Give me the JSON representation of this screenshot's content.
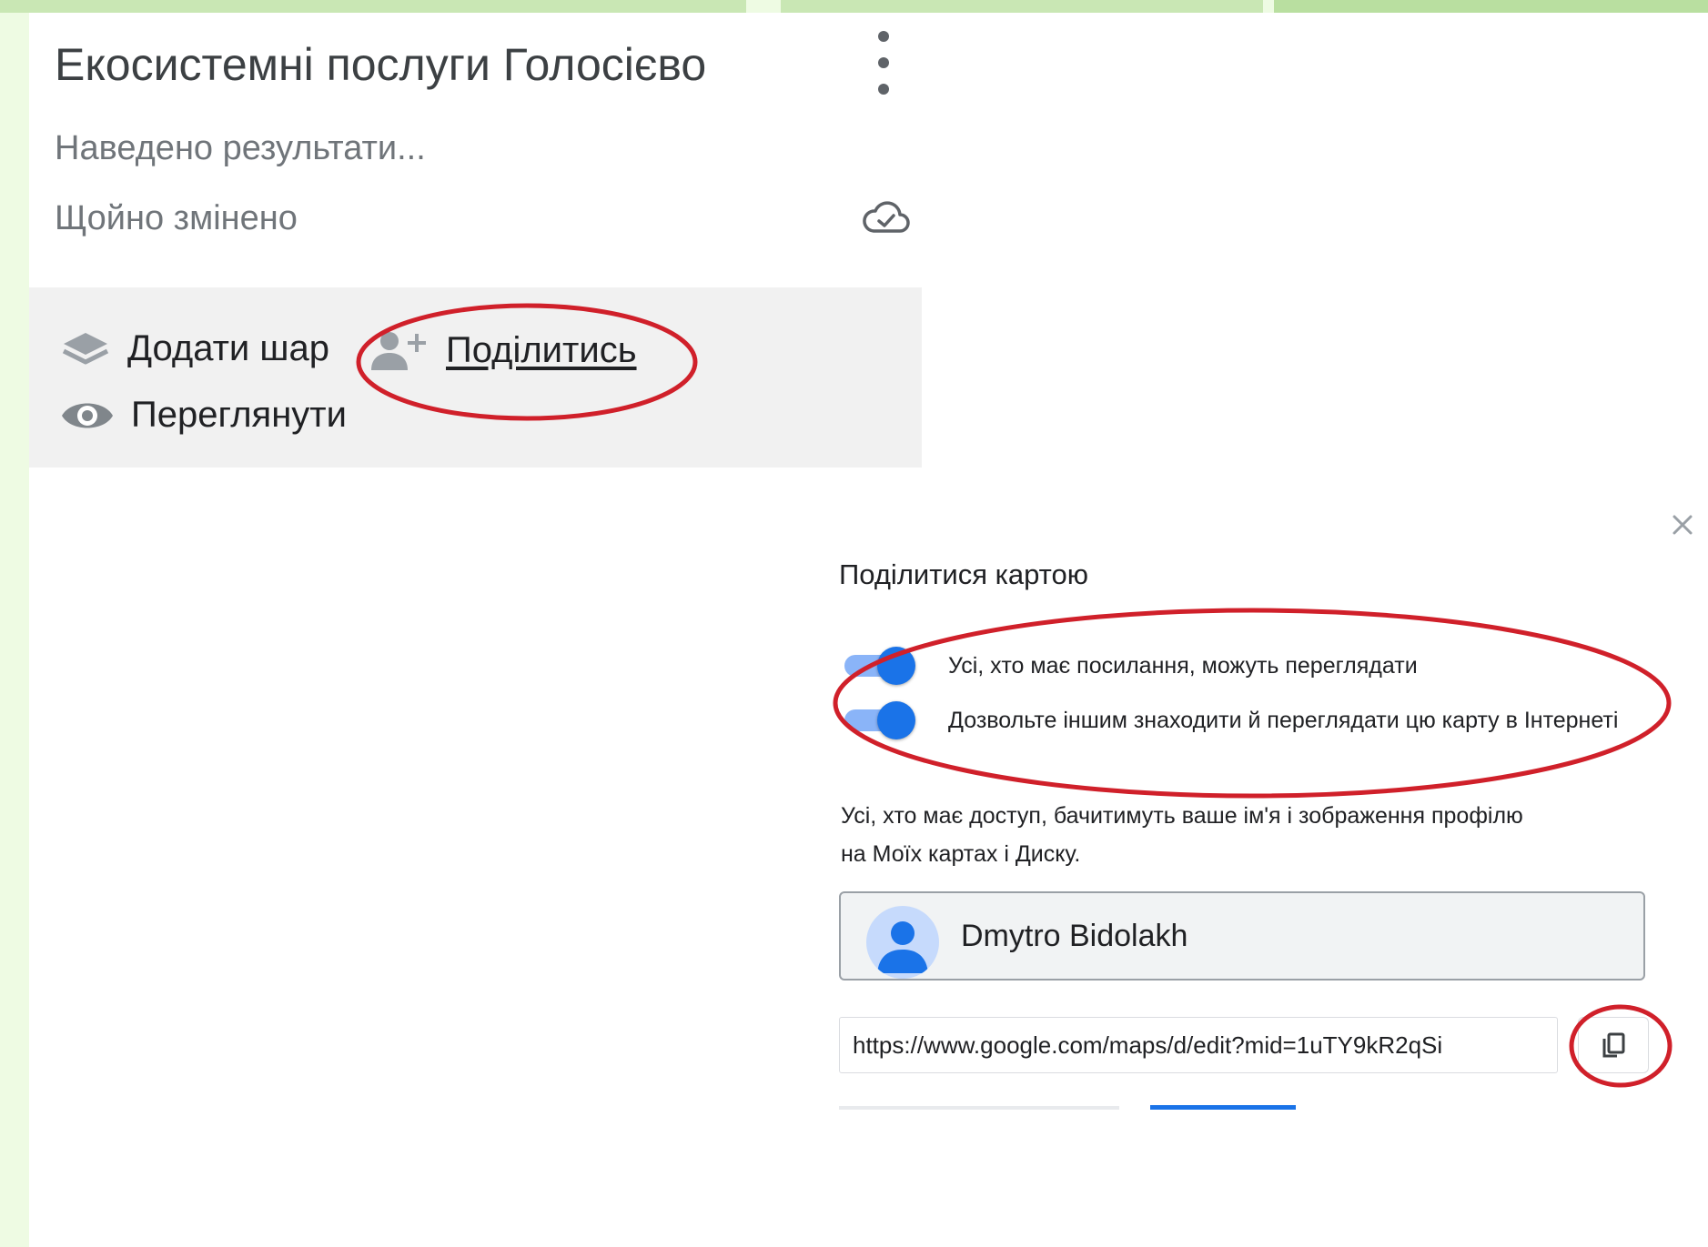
{
  "colors": {
    "background": "#eefbe3",
    "panel": "#ffffff",
    "toolbar_bg": "#f1f1f1",
    "annotation_red": "#d0202a",
    "toggle_on": "#1a73e8",
    "toggle_track": "#8ab4f8",
    "muted_text": "#70757a"
  },
  "map": {
    "title": "Екосистемні послуги Голосієво",
    "description": "Наведено результати...",
    "status": "Щойно змінено",
    "menu_icon": "more-vert-icon",
    "sync_icon": "cloud-done-icon"
  },
  "toolbar": {
    "add_layer": {
      "label": "Додати шар",
      "icon": "layers-icon"
    },
    "share": {
      "label": "Поділитись",
      "icon": "person-add-icon"
    },
    "preview": {
      "label": "Переглянути",
      "icon": "eye-icon"
    }
  },
  "share_dialog": {
    "title": "Поділитися картою",
    "close_icon": "close-icon",
    "toggles": [
      {
        "label": "Усі, хто має посилання, можуть переглядати",
        "on": true
      },
      {
        "label": "Дозвольте іншим знаходити й переглядати цю карту в Інтернеті",
        "on": true
      }
    ],
    "notice": "Усі, хто має доступ, бачитимуть ваше ім'я і зображення профілю на Моїх картах і Диску.",
    "owner": {
      "name": "Dmytro Bidolakh",
      "avatar_icon": "account-avatar-icon"
    },
    "link": {
      "value": "https://www.google.com/maps/d/edit?mid=1uTY9kR2qSi",
      "copy_icon": "copy-icon"
    }
  }
}
